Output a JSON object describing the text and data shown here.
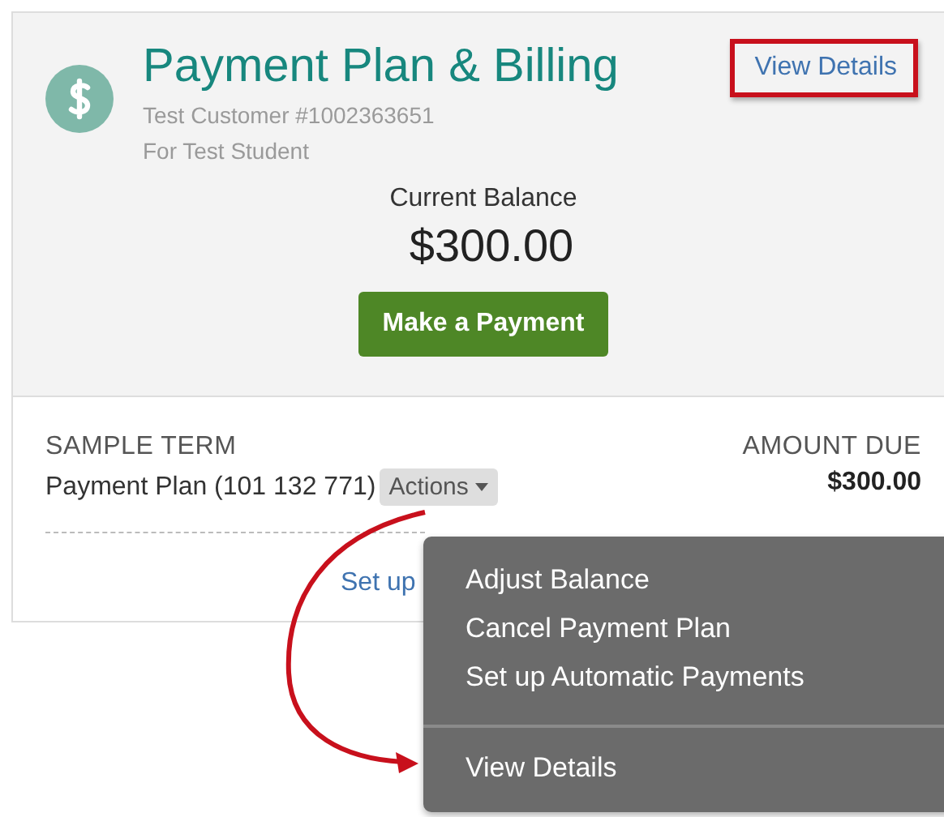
{
  "header": {
    "title": "Payment Plan & Billing",
    "customer": "Test Customer #1002363651",
    "student": "For Test Student",
    "view_details": "View Details",
    "balance_label": "Current Balance",
    "balance": "$300.00",
    "pay_button": "Make a Payment"
  },
  "term": {
    "name": "SAMPLE TERM",
    "plan": "Payment Plan (101 132 771)",
    "actions": "Actions",
    "amount_label": "AMOUNT DUE",
    "amount": "$300.00",
    "setup_link": "Set up"
  },
  "menu": {
    "items": [
      "Adjust Balance",
      "Cancel Payment Plan",
      "Set up Automatic Payments"
    ],
    "footer_item": "View Details"
  }
}
